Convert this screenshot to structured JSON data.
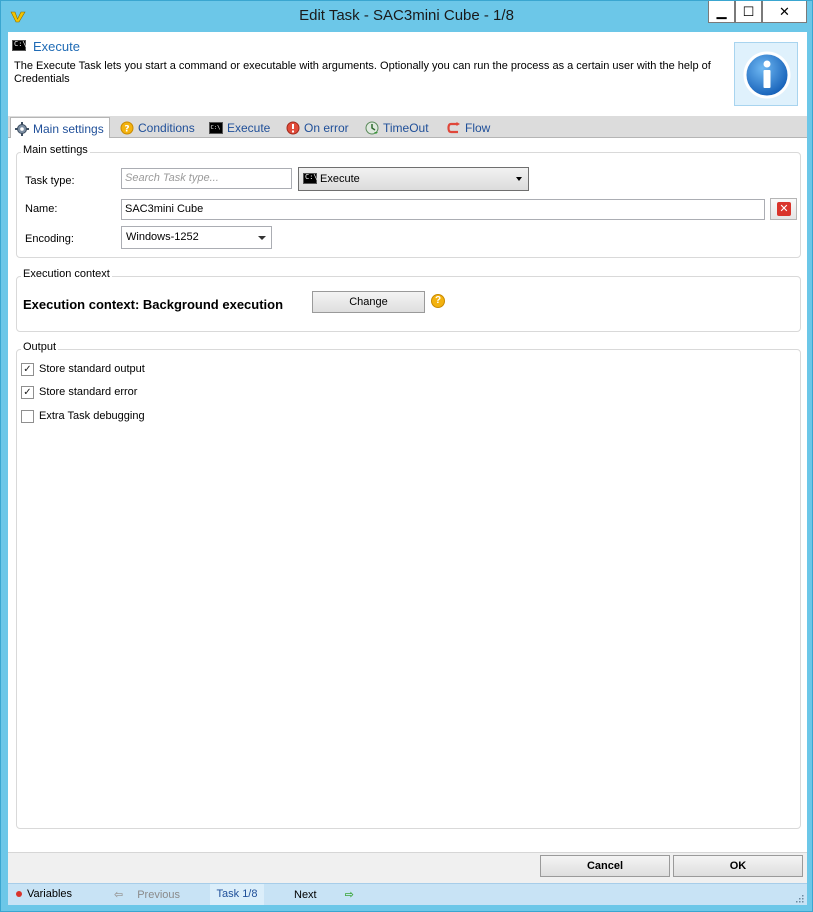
{
  "window": {
    "title": "Edit Task - SAC3mini Cube - 1/8",
    "min_symbol": "▁",
    "max_symbol": "☐",
    "close_symbol": "✕"
  },
  "header": {
    "icon_text": "C:\\",
    "title": "Execute",
    "description": "The Execute Task lets you start a command or executable with arguments. Optionally you can run the process as a certain user with the help of Credentials"
  },
  "tabs": [
    {
      "label": "Main settings",
      "icon": "settings-gear-icon"
    },
    {
      "label": "Conditions",
      "icon": "question-icon"
    },
    {
      "label": "Execute",
      "icon": "console-icon"
    },
    {
      "label": "On error",
      "icon": "error-icon"
    },
    {
      "label": "TimeOut",
      "icon": "timeout-icon"
    },
    {
      "label": "Flow",
      "icon": "flow-icon"
    }
  ],
  "main_settings": {
    "group_label": "Main settings",
    "task_type_label": "Task type:",
    "task_type_placeholder": "Search Task type...",
    "task_type_value": "Execute",
    "name_label": "Name:",
    "name_value": "SAC3mini Cube",
    "encoding_label": "Encoding:",
    "encoding_value": "Windows-1252"
  },
  "execution_context": {
    "group_label": "Execution context",
    "text": "Execution context: Background execution",
    "change_label": "Change",
    "help_symbol": "?"
  },
  "output": {
    "group_label": "Output",
    "options": [
      {
        "label": "Store standard output",
        "checked": true
      },
      {
        "label": "Store standard error",
        "checked": true
      },
      {
        "label": "Extra Task debugging",
        "checked": false
      }
    ],
    "check_symbol": "✓"
  },
  "footer": {
    "cancel_label": "Cancel",
    "ok_label": "OK"
  },
  "statusbar": {
    "variables_label": "Variables",
    "previous_label": "Previous",
    "task_label": "Task 1/8",
    "next_label": "Next"
  },
  "colors": {
    "titlebar": "#6cc7e8",
    "accent": "#1f6bb5",
    "statusbar": "#c8e3f5"
  }
}
